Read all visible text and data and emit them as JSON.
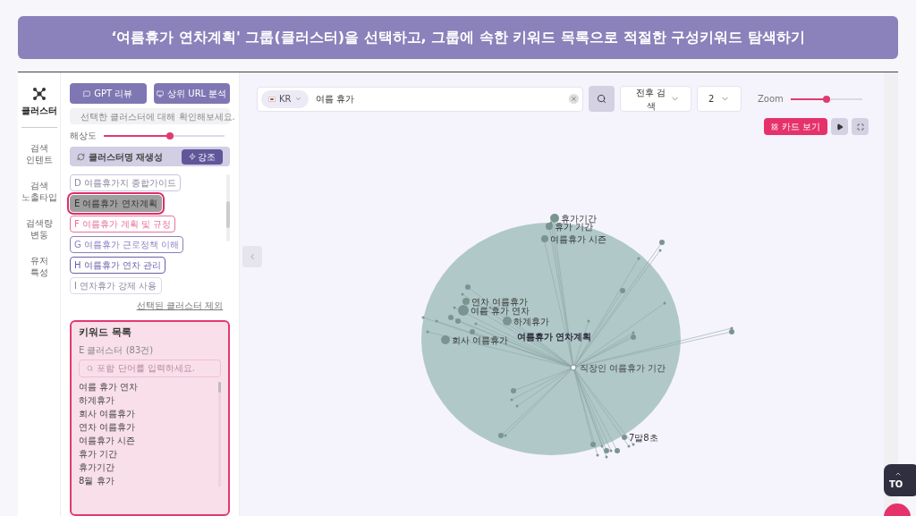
{
  "banner": {
    "title": "‘여름휴가 연차계획' 그룹(클러스터)을 선택하고, 그룹에 속한 키워드 목록으로 적절한 구성키워드 탐색하기"
  },
  "nav": {
    "items": [
      {
        "label": "클러스터",
        "selected": true
      },
      {
        "label": "검색\n인텐트",
        "selected": false
      },
      {
        "label": "검색\n노출타입",
        "selected": false
      },
      {
        "label": "검색량\n변동",
        "selected": false
      },
      {
        "label": "유저\n특성",
        "selected": false
      }
    ]
  },
  "panel": {
    "buttons": [
      "GPT 리뷰",
      "상위 URL 분석"
    ],
    "notice": "선택한 클러스터에 대해 확인해보세요.",
    "resolution": {
      "label": "해상도",
      "level": 0.55
    },
    "regen": {
      "label": "클러스터명 재생성",
      "button": "강조"
    },
    "clusters": [
      {
        "label": "D 여름휴가지 종합가이드",
        "selected": false,
        "color": "#c9c4dd"
      },
      {
        "label": "E 여름휴가 연차계획",
        "selected": true,
        "color": "#9e9e9e"
      },
      {
        "label": "F 여름휴가 계획 및 규정",
        "selected": false,
        "color": "#e8709a"
      },
      {
        "label": "G 여름휴가 근로정책 이해",
        "selected": false,
        "color": "#8a7fc0"
      },
      {
        "label": "H 여름휴가 연차 관리",
        "selected": false,
        "color": "#6a5fa8"
      },
      {
        "label": "I 연차휴가 강제 사용",
        "selected": false,
        "color": "#dcd8ea"
      }
    ],
    "exclude_link": "선택된 클러스터 제외",
    "keyword_list": {
      "title": "키워드 목록",
      "subtitle": "E 클러스터 (83건)",
      "placeholder": "포함 단어를 입력하세요.",
      "items": [
        "여름 휴가 연차",
        "하계휴가",
        "회사 여름휴가",
        "연차 여름휴가",
        "여름휴가 시즌",
        "휴가 기간",
        "휴가기간",
        "8월 휴가"
      ]
    }
  },
  "search": {
    "country": "KR",
    "query": "여름 휴가",
    "mode": "전후 검색",
    "depth": "2",
    "zoom": {
      "label": "Zoom",
      "level": 0.5
    },
    "card_button": "카드 보기"
  },
  "graph": {
    "cluster_label": "여름휴가 연차계획",
    "center_label": "직장인 여름휴가 기간",
    "nodes": [
      "휴가기간",
      "휴가 기간",
      "여름휴가 시즌",
      "연차 여름휴가",
      "여름 휴가 연차",
      "하계휴가",
      "회사 여름휴가",
      "7말8초"
    ]
  },
  "top_button": "TO"
}
